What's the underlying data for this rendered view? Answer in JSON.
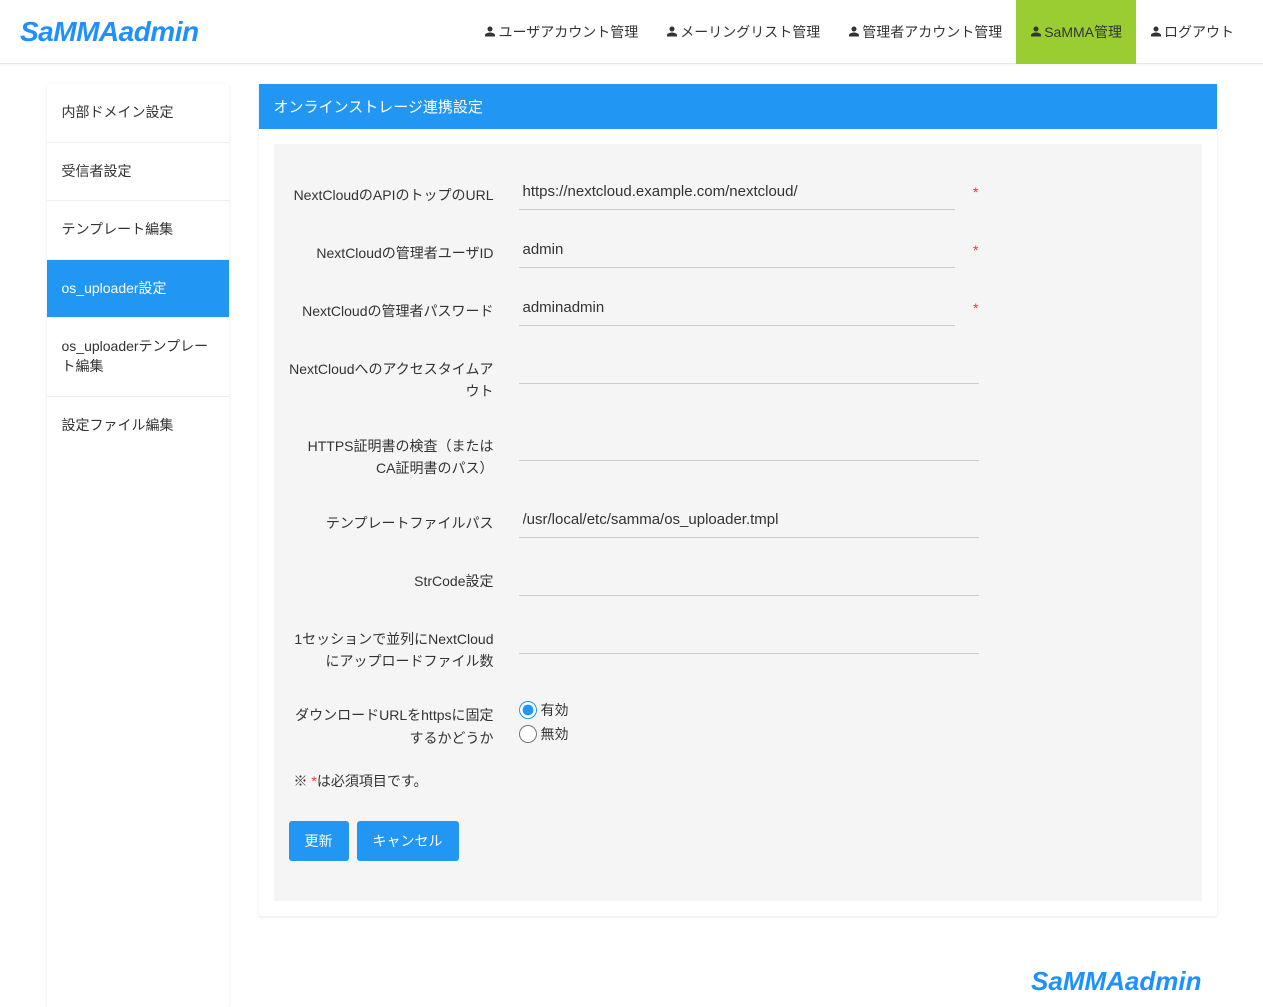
{
  "logo": "SaMMAadmin",
  "nav": [
    {
      "label": "ユーザアカウント管理"
    },
    {
      "label": "メーリングリスト管理"
    },
    {
      "label": "管理者アカウント管理"
    },
    {
      "label": "SaMMA管理"
    },
    {
      "label": "ログアウト"
    }
  ],
  "sidebar": {
    "items": [
      {
        "label": "内部ドメイン設定"
      },
      {
        "label": "受信者設定"
      },
      {
        "label": "テンプレート編集"
      },
      {
        "label": "os_uploader設定"
      },
      {
        "label": "os_uploaderテンプレート編集"
      },
      {
        "label": "設定ファイル編集"
      }
    ]
  },
  "panel": {
    "title": "オンラインストレージ連携設定"
  },
  "form": {
    "fields": {
      "api_url": {
        "label": "NextCloudのAPIのトップのURL",
        "value": "https://nextcloud.example.com/nextcloud/",
        "required": true
      },
      "admin_user": {
        "label": "NextCloudの管理者ユーザID",
        "value": "admin",
        "required": true
      },
      "admin_pass": {
        "label": "NextCloudの管理者パスワード",
        "value": "adminadmin",
        "required": true
      },
      "timeout": {
        "label": "NextCloudへのアクセスタイムアウト",
        "value": ""
      },
      "https_cert": {
        "label": "HTTPS証明書の検査（またはCA証明書のパス）",
        "value": ""
      },
      "tmpl_path": {
        "label": "テンプレートファイルパス",
        "value": "/usr/local/etc/samma/os_uploader.tmpl"
      },
      "strcode": {
        "label": "StrCode設定",
        "value": ""
      },
      "parallel": {
        "label": "1セッションで並列にNextCloudにアップロードファイル数",
        "value": ""
      },
      "https_fixed": {
        "label": "ダウンロードURLをhttpsに固定するかどうか"
      }
    },
    "radio": {
      "enabled": "有効",
      "disabled": "無効"
    },
    "note_prefix": "※ ",
    "note_star": "*",
    "note_suffix": "は必須項目です。",
    "required_mark": "*",
    "submit": "更新",
    "cancel": "キャンセル"
  },
  "footer": {
    "logo": "SaMMAadmin"
  }
}
